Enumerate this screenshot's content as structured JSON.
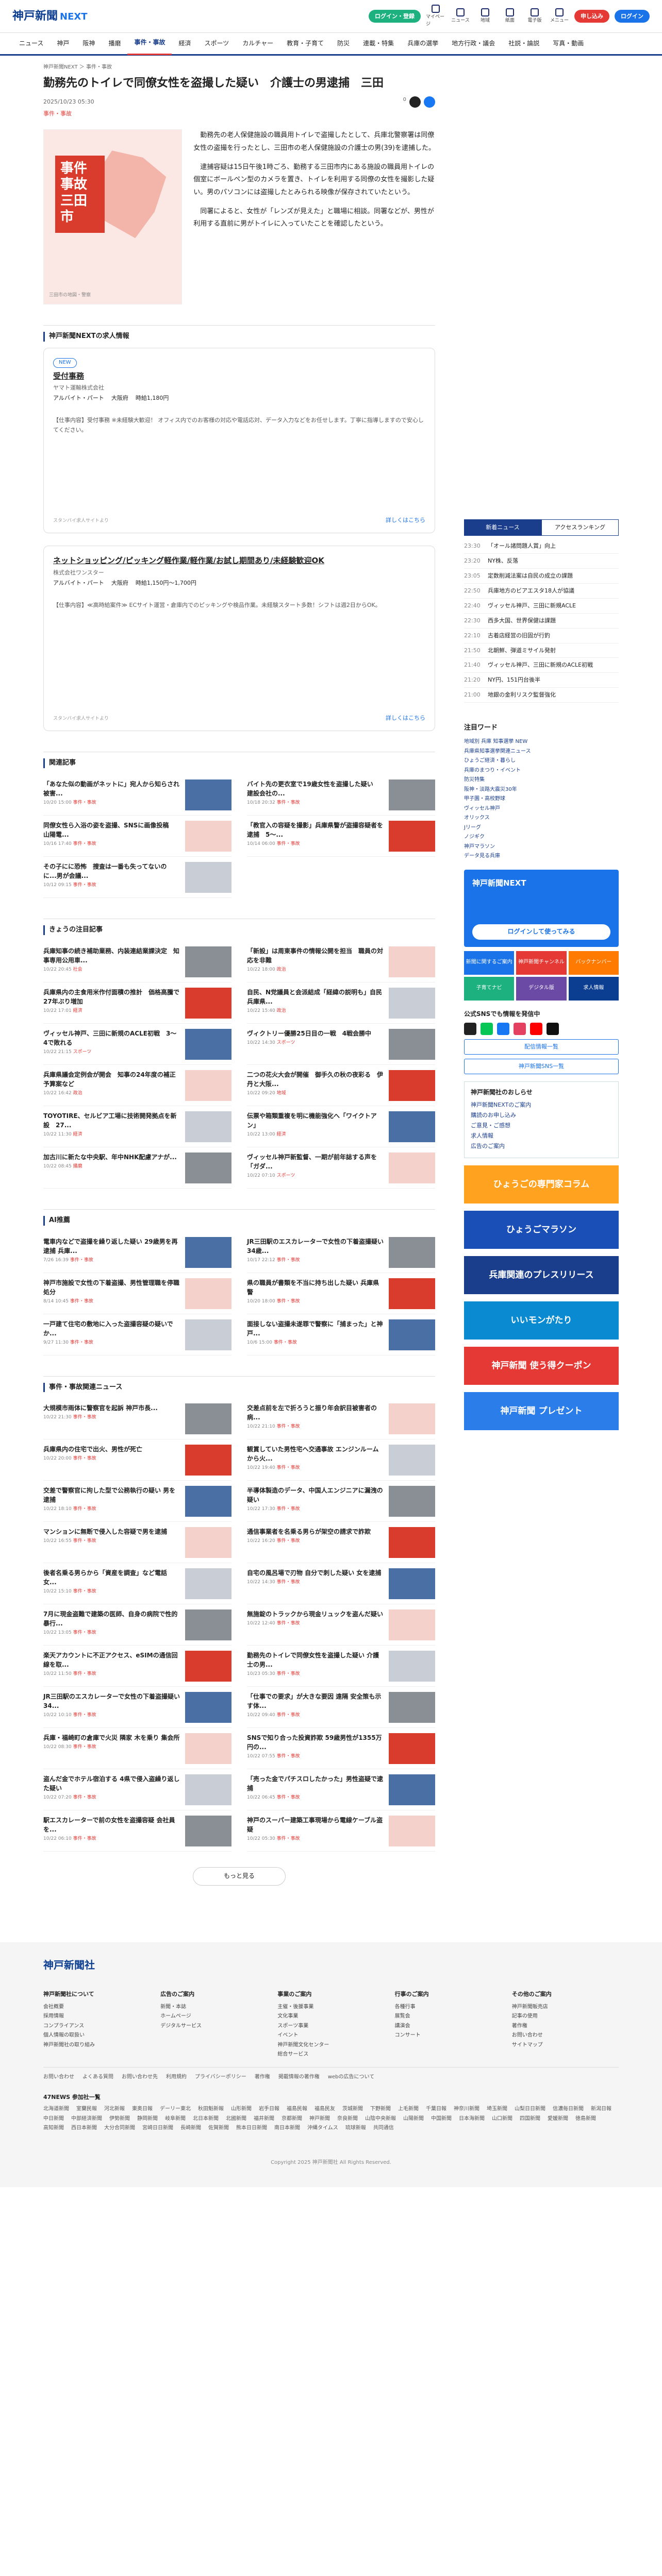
{
  "header": {
    "logo": "神戸新聞",
    "logo_sub": "NEXT",
    "btn_green": "ログイン・登録",
    "btn_blue": "有料会員",
    "btn_red": "申し込み",
    "btn_outline": "ログイン",
    "icons": [
      "マイページ",
      "ニュース",
      "地域",
      "紙面",
      "電子版",
      "メニュー"
    ]
  },
  "nav": [
    "ニュース",
    "神戸",
    "阪神",
    "播磨",
    "事件・事故",
    "経済",
    "スポーツ",
    "カルチャー",
    "教育・子育て",
    "防災",
    "連載・特集",
    "兵庫の選挙",
    "地方行政・議会",
    "社説・論説",
    "写真・動画"
  ],
  "nav_active": 4,
  "article": {
    "crumb": "神戸新聞NEXT ＞ 事件・事故",
    "title": "勤務先のトイレで同僚女性を盗撮した疑い　介護士の男逮捕　三田",
    "date": "2025/10/23 05:30",
    "tag": "事件・事故",
    "share_count": "0",
    "thumb_label": "事件 事故 三田市",
    "thumb_caption": "三田市の地図・警察",
    "body": [
      "勤務先の老人保健施設の職員用トイレで盗撮したとして、兵庫北警察署は同僚女性の盗撮を行ったとし、三田市の老人保健施設の介護士の男(39)を逮捕した。",
      "逮捕容疑は15日午後1時ごろ、勤務する三田市内にある施設の職員用トイレの個室にボールペン型のカメラを置き、トイレを利用する同僚の女性を撮影した疑い。男のパソコンには盗撮したとみられる映像が保存されていたという。",
      "同署によると、女性が「レンズが見えた」と職場に相談。同署などが、男性が利用する直前に男がトイレに入っていたことを確認したという。"
    ]
  },
  "jobs": {
    "heading": "神戸新聞NEXTの求人情報",
    "cards": [
      {
        "new": "NEW",
        "title": "受付事務",
        "company": "ヤマト運輸株式会社",
        "type": "アルバイト・パート",
        "place": "大阪府",
        "pay": "時給1,180円",
        "desc": "【仕事内容】受付事務 ※未経験大歓迎！ オフィス内でのお客様の対応や電話応対、データ入力などをお任せします。丁寧に指導しますので安心してください。",
        "more": "詳しくはこちら",
        "src": "スタンバイ求人サイトより"
      },
      {
        "title": "ネットショッピング/ピッキング軽作業/軽作業/お試し期間あり/未経験歓迎OK",
        "company": "株式会社ワンスター",
        "type": "アルバイト・パート",
        "place": "大阪府",
        "pay": "時給1,150円〜1,700円",
        "desc": "【仕事内容】≪高時給案件≫ ECサイト運営・倉庫内でのピッキングや検品作業。未経験スタート多数！シフトは週2日からOK。",
        "more": "詳しくはこちら",
        "src": "スタンバイ求人サイトより"
      }
    ]
  },
  "related": {
    "heading": "関連記事",
    "items": [
      {
        "t": "「あなた似の動画がネットに」宛人から知らされ被害...",
        "d": "10/20 15:00",
        "c": "事件・事故"
      },
      {
        "t": "バイト先の更衣室で19歳女性を盗撮した疑い　建設会社の...",
        "d": "10/18 20:32",
        "c": "事件・事故"
      },
      {
        "t": "同僚女性ら入浴の姿を盗撮、SNSに画像投稿　山陽電...",
        "d": "10/16 17:40",
        "c": "事件・事故"
      },
      {
        "t": "「教官入の容疑を撮影」兵庫県警が盗撮容疑者を逮捕　5〜...",
        "d": "10/14 06:00",
        "c": "事件・事故"
      },
      {
        "t": "その子にに恐怖　捜査は一番も失ってないのに...男が会議...",
        "d": "10/12 09:15",
        "c": "事件・事故"
      }
    ]
  },
  "today": {
    "heading": "きょうの注目記事",
    "items": [
      {
        "t": "兵庫知事の続き補助業務、内装連結業課決定　知事専用公用車...",
        "d": "10/22 20:45",
        "c": "社会"
      },
      {
        "t": "「新設」は周東事件の情報公開を担当　職員の対応を非難",
        "d": "10/22 18:00",
        "c": "政治"
      },
      {
        "t": "兵庫県内の主食用米作付面積の推計　価格高騰で27年ぶり増加",
        "d": "10/22 17:01",
        "c": "経済"
      },
      {
        "t": "自民、N党議員と会派結成「経緯の説明も」自民兵庫県...",
        "d": "10/22 15:40",
        "c": "政治"
      },
      {
        "t": "ヴィッセル神戸、三田に新規のACLE初戦　3〜4で敗れる",
        "d": "10/22 21:15",
        "c": "スポーツ"
      },
      {
        "t": "ヴィクトリー優勝25日目の一戦　4戦会勝中",
        "d": "10/22 14:30",
        "c": "スポーツ"
      },
      {
        "t": "兵庫県議会定例会が開会　知事の24年度の補正予算案など",
        "d": "10/22 16:42",
        "c": "政治"
      },
      {
        "t": "二つの花火大会が開催　御手久の秋の夜彩る　伊丹と大阪...",
        "d": "10/22 09:20",
        "c": "地域"
      },
      {
        "t": "TOYOTIRE、セルビア工場に技術開発拠点を新設　27...",
        "d": "10/22 11:30",
        "c": "経済"
      },
      {
        "t": "伝票や箱類重複を明に機能強化へ「ワイクトアン」",
        "d": "10/22 13:00",
        "c": "経済"
      },
      {
        "t": "加古川に新たな中央駅、年中NHK配慮アナが...",
        "d": "10/22 08:45",
        "c": "播磨"
      },
      {
        "t": "ヴィッセル神戸新監督、一期が前年誌する声を「ガダ...",
        "d": "10/22 07:10",
        "c": "スポーツ"
      }
    ]
  },
  "ai": {
    "heading": "AI推薦",
    "items": [
      {
        "t": "電車内などで盗撮を繰り返した疑い 29歳男を再逮捕 兵庫...",
        "d": "7/26 16:39",
        "c": "事件・事故"
      },
      {
        "t": "JR三田駅のエスカレーターで女性の下着盗撮疑い 34歳...",
        "d": "10/17 22:12",
        "c": "事件・事故"
      },
      {
        "t": "神戸市施設で女性の下着盗撮、男性管理職を停職処分",
        "d": "8/14 10:45",
        "c": "事件・事故"
      },
      {
        "t": "県の職員が書類を不当に持ち出した疑い 兵庫県警",
        "d": "10/20 18:00",
        "c": "事件・事故"
      },
      {
        "t": "一戸建て住宅の敷地に入った盗撮容疑の疑いでか...",
        "d": "9/27 11:30",
        "c": "事件・事故"
      },
      {
        "t": "面接しない盗撮未遂罪で警察に「捕まった」と神戸...",
        "d": "10/6 15:00",
        "c": "事件・事故"
      }
    ]
  },
  "crime": {
    "heading": "事件・事故関連ニュース",
    "items": [
      {
        "t": "大規模市雨体に警察官を起訴 神戸市長...",
        "d": "10/22 21:30",
        "c": "事件・事故"
      },
      {
        "t": "交差点前を左で折ろうと振り年会訳目被害者の病...",
        "d": "10/22 21:10",
        "c": "事件・事故"
      },
      {
        "t": "兵庫県内の住宅で出火、男性が死亡",
        "d": "10/22 20:00",
        "c": "事件・事故"
      },
      {
        "t": "観賞していた男性宅へ交通事故 エンジンルームから火...",
        "d": "10/22 19:40",
        "c": "事件・事故"
      },
      {
        "t": "交差で警察官に拘した型で公務執行の疑い 男を逮捕",
        "d": "10/22 18:10",
        "c": "事件・事故"
      },
      {
        "t": "半導体製造のデータ、中国人エンジニアに漏洩の疑い",
        "d": "10/22 17:30",
        "c": "事件・事故"
      },
      {
        "t": "マンションに無断で侵入した容疑で男を逮捕",
        "d": "10/22 16:55",
        "c": "事件・事故"
      },
      {
        "t": "通信事業者を名乗る男らが架空の請求で詐欺",
        "d": "10/22 16:20",
        "c": "事件・事故"
      },
      {
        "t": "後者名乗る男らから「資産を調査」など電話 女...",
        "d": "10/22 15:10",
        "c": "事件・事故"
      },
      {
        "t": "自宅の風呂場で刃物 自分で刺した疑い 女を逮捕",
        "d": "10/22 14:30",
        "c": "事件・事故"
      },
      {
        "t": "7月に現金盗難で建築の医師、自身の病院で性的暴行...",
        "d": "10/22 13:05",
        "c": "事件・事故"
      },
      {
        "t": "無施錠のトラックから現金リュックを盗んだ疑い",
        "d": "10/22 12:40",
        "c": "事件・事故"
      },
      {
        "t": "楽天アカウントに不正アクセス、eSIMの通信回線を取...",
        "d": "10/22 11:50",
        "c": "事件・事故"
      },
      {
        "t": "勤務先のトイレで同僚女性を盗撮した疑い 介護士の男...",
        "d": "10/23 05:30",
        "c": "事件・事故"
      },
      {
        "t": "JR三田駅のエスカレーターで女性の下着盗撮疑い 34...",
        "d": "10/22 10:10",
        "c": "事件・事故"
      },
      {
        "t": "「仕事での要求」が大きな要因 遠隔 安全策も示す体...",
        "d": "10/22 09:40",
        "c": "事件・事故"
      },
      {
        "t": "兵庫・福崎町の倉庫で火災 隣家 木を乗り 集会所",
        "d": "10/22 08:30",
        "c": "事件・事故"
      },
      {
        "t": "SNSで知り合った投資詐欺 59歳男性が1355万円の...",
        "d": "10/22 07:55",
        "c": "事件・事故"
      },
      {
        "t": "盗んだ金でホテル宿泊する 4県で侵入盗繰り返した疑い",
        "d": "10/22 07:20",
        "c": "事件・事故"
      },
      {
        "t": "「売った金でパチスロしたかった」男性盗疑で逮捕",
        "d": "10/22 06:45",
        "c": "事件・事故"
      },
      {
        "t": "駅エスカレーターで前の女性を盗撮容疑 会社員を...",
        "d": "10/22 06:10",
        "c": "事件・事故"
      },
      {
        "t": "神戸のスーパー建築工事現場から電線ケーブル盗疑",
        "d": "10/22 05:30",
        "c": "事件・事故"
      }
    ]
  },
  "more_label": "もっと見る",
  "side": {
    "tabs": [
      "新着ニュース",
      "アクセスランキング"
    ],
    "rank": [
      {
        "time": "23:30",
        "t": "「オール諸問題人賞」向上"
      },
      {
        "time": "23:20",
        "t": "NY株、反落"
      },
      {
        "time": "23:05",
        "t": "定数削減法案は自民の成立の課題"
      },
      {
        "time": "22:50",
        "t": "兵庫地方のビアエスタ18人が協議"
      },
      {
        "time": "22:40",
        "t": "ヴィッセル神戸、三田に新規ACLE"
      },
      {
        "time": "22:30",
        "t": "西多大国、世界保健は課題"
      },
      {
        "time": "22:10",
        "t": "古着店経営の旧固が行釣"
      },
      {
        "time": "21:50",
        "t": "北朝鮮、弾道ミサイル発射"
      },
      {
        "time": "21:40",
        "t": "ヴィッセル神戸、三田に新規のACLE初戦"
      },
      {
        "time": "21:20",
        "t": "NY円、151円台後半"
      },
      {
        "time": "21:00",
        "t": "地銀の金利リスク監督強化"
      }
    ],
    "noti_head": "注目ワード",
    "noti": [
      "地域別 兵庫 知事選挙 NEW",
      "兵庫県知事選挙関連ニュース",
      "ひょうご経済・暮らし",
      "兵庫のまつり・イベント",
      "防災特集",
      "阪神・淡路大震災30年",
      "甲子園・高校野球",
      "ヴィッセル神戸",
      "オリックス",
      "Jリーグ",
      "ノジギク",
      "神戸マラソン",
      "データ見る兵庫"
    ],
    "blue_title": "神戸新聞NEXT",
    "blue_btn": "ログインして使ってみる",
    "tiles": [
      "新聞に関するご案内",
      "神戸新聞チャンネル",
      "バックナンバー",
      "子育てナビ",
      "デジタル版",
      "求人情報"
    ],
    "sns_head": "公式SNSでも情報を発信中",
    "sns_btn1": "配信情報一覧",
    "sns_btn2": "神戸新聞SNS一覧",
    "guide_head": "神戸新聞社のおしらせ",
    "guide": [
      "神戸新聞NEXTのご案内",
      "購読のお申し込み",
      "ご意見・ご感想",
      "求人情報",
      "広告のご案内"
    ],
    "banners": [
      "ひょうごの専門家コラム",
      "ひょうごマラソン",
      "兵庫関連のプレスリリース",
      "いいモンがたり",
      "神戸新聞 使う得クーポン",
      "神戸新聞 プレゼント"
    ]
  },
  "footer": {
    "logo": "神戸新聞社",
    "cols": [
      {
        "h": "神戸新聞社について",
        "l": [
          "会社概要",
          "採用情報",
          "コンプライアンス",
          "個人情報の取扱い",
          "神戸新聞社の取り組み"
        ]
      },
      {
        "h": "広告のご案内",
        "l": [
          "新聞・本誌",
          "ホームページ",
          "デジタルサービス"
        ]
      },
      {
        "h": "事業のご案内",
        "l": [
          "主催・後援事業",
          "文化事業",
          "スポーツ事業",
          "イベント",
          "神戸新聞文化センター",
          "総合サービス"
        ]
      },
      {
        "h": "行事のご案内",
        "l": [
          "各種行事",
          "展覧会",
          "講演会",
          "コンサート"
        ]
      },
      {
        "h": "その他のご案内",
        "l": [
          "神戸新聞販売店",
          "記事の使用",
          "著作権",
          "お問い合わせ",
          "サイトマップ"
        ]
      }
    ],
    "bar": [
      "お問い合わせ",
      "よくある質問",
      "お問い合わせ先",
      "利用規約",
      "プライバシーポリシー",
      "著作権",
      "掲載情報の著作権",
      "webの広告について"
    ],
    "n47": "47NEWS 参加社一覧",
    "n47list": [
      "北海道新聞",
      "室蘭民報",
      "河北新報",
      "東奥日報",
      "デーリー東北",
      "秋田魁新報",
      "山形新聞",
      "岩手日報",
      "福島民報",
      "福島民友",
      "茨城新聞",
      "下野新聞",
      "上毛新聞",
      "千葉日報",
      "神奈川新聞",
      "埼玉新聞",
      "山梨日日新聞",
      "信濃毎日新聞",
      "新潟日報",
      "中日新聞",
      "中部経済新聞",
      "伊勢新聞",
      "静岡新聞",
      "岐阜新聞",
      "北日本新聞",
      "北國新聞",
      "福井新聞",
      "京都新聞",
      "神戸新聞",
      "奈良新聞",
      "山陰中央新報",
      "山陽新聞",
      "中国新聞",
      "日本海新聞",
      "山口新聞",
      "四国新聞",
      "愛媛新聞",
      "徳島新聞",
      "高知新聞",
      "西日本新聞",
      "大分合同新聞",
      "宮崎日日新聞",
      "長崎新聞",
      "佐賀新聞",
      "熊本日日新聞",
      "南日本新聞",
      "沖縄タイムス",
      "琉球新報",
      "共同通信"
    ],
    "copy": "Copyright 2025 神戸新聞社 All Rights Reserved."
  }
}
